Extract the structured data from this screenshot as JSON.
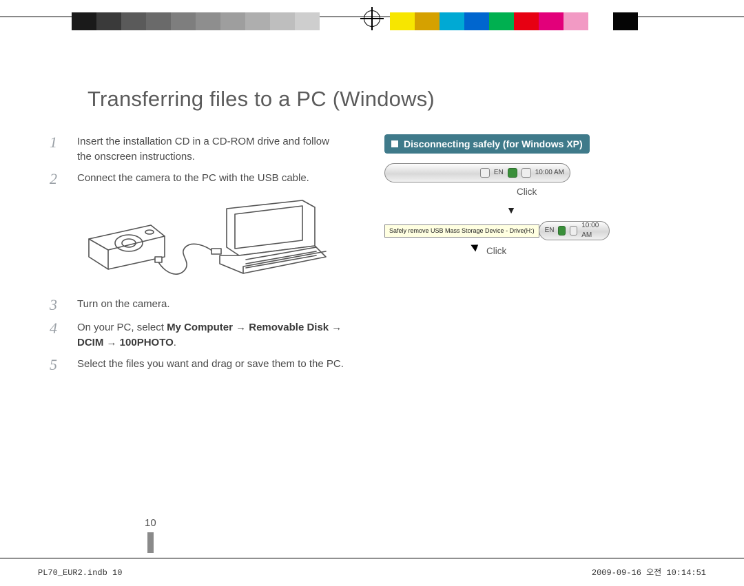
{
  "title": "Transferring files to a PC (Windows)",
  "steps": {
    "s1": {
      "num": "1",
      "text": "Insert the installation CD in a CD-ROM drive and follow the onscreen instructions."
    },
    "s2": {
      "num": "2",
      "text": "Connect the camera to the PC with the USB cable."
    },
    "s3": {
      "num": "3",
      "text": "Turn on the camera."
    },
    "s4": {
      "num": "4",
      "prefix": "On your PC, select ",
      "path1": "My Computer",
      "arrow": " → ",
      "path2": "Removable Disk",
      "path3": "DCIM",
      "path4": "100PHOTO",
      "suffix": "."
    },
    "s5": {
      "num": "5",
      "text": "Select the files you want and drag or save them to the PC."
    }
  },
  "callout": "Disconnecting safely (for Windows XP)",
  "tray": {
    "lang": "EN",
    "time": "10:00 AM",
    "click": "Click",
    "arrow": "▼",
    "tooltip": "Safely remove USB Mass Storage Device - Drive(H:)"
  },
  "page_number": "10",
  "footer": {
    "left": "PL70_EUR2.indb   10",
    "right": "2009-09-16   오전 10:14:51"
  }
}
